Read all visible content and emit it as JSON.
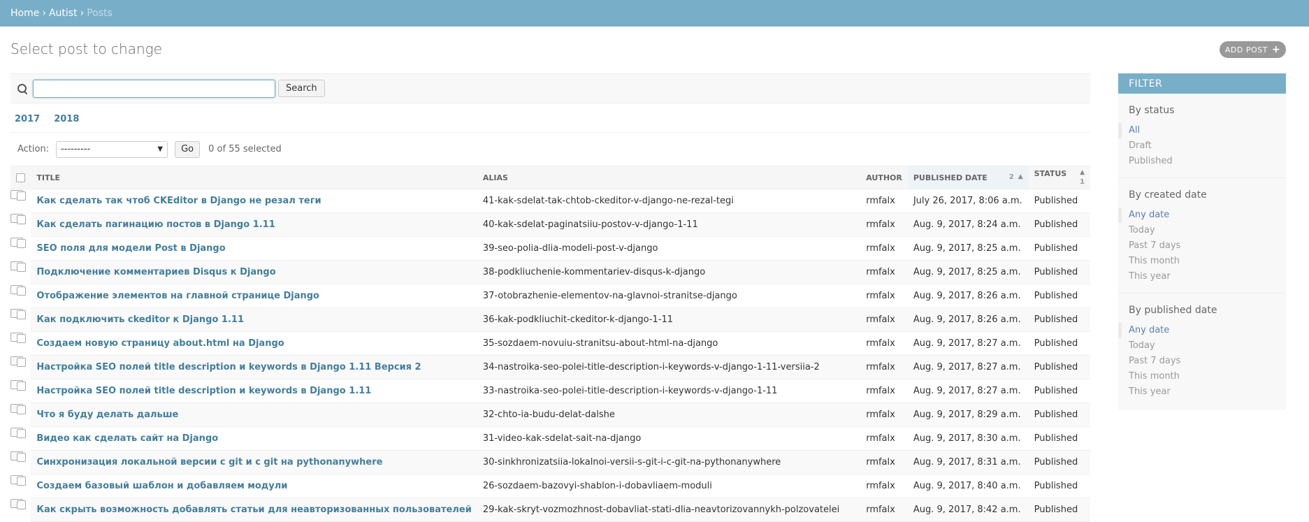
{
  "breadcrumbs": {
    "home": "Home",
    "sep1": "›",
    "app": "Autist",
    "sep2": "›",
    "current": "Posts"
  },
  "page_title": "Select post to change",
  "add_button": {
    "label": "Add post",
    "icon": "+"
  },
  "search": {
    "value": "",
    "placeholder": "",
    "button": "Search"
  },
  "date_hierarchy": [
    "2017",
    "2018"
  ],
  "actions": {
    "label": "Action:",
    "selected_option": "---------",
    "go": "Go",
    "selected_count": "0 of 55 selected"
  },
  "table": {
    "headers": {
      "title": "Title",
      "alias": "Alias",
      "author": "Author",
      "published": "Published date",
      "published_sort": "2",
      "status": "Status",
      "status_sort": "1"
    },
    "rows": [
      {
        "title": "Как сделать так чтоб CKEditor в Django не резал теги",
        "alias": "41-kak-sdelat-tak-chtob-ckeditor-v-django-ne-rezal-tegi",
        "author": "rmfalx",
        "published": "July 26, 2017, 8:06 a.m.",
        "status": "Published"
      },
      {
        "title": "Как сделать пагинацию постов в Django 1.11",
        "alias": "40-kak-sdelat-paginatsiiu-postov-v-django-1-11",
        "author": "rmfalx",
        "published": "Aug. 9, 2017, 8:24 a.m.",
        "status": "Published"
      },
      {
        "title": "SEO поля для модели Post в Django",
        "alias": "39-seo-polia-dlia-modeli-post-v-django",
        "author": "rmfalx",
        "published": "Aug. 9, 2017, 8:25 a.m.",
        "status": "Published"
      },
      {
        "title": "Подключение комментариев Disqus к Django",
        "alias": "38-podkliuchenie-kommentariev-disqus-k-django",
        "author": "rmfalx",
        "published": "Aug. 9, 2017, 8:25 a.m.",
        "status": "Published"
      },
      {
        "title": "Отображение элементов на главной странице Django",
        "alias": "37-otobrazhenie-elementov-na-glavnoi-stranitse-django",
        "author": "rmfalx",
        "published": "Aug. 9, 2017, 8:26 a.m.",
        "status": "Published"
      },
      {
        "title": "Как подключить ckeditor к Django 1.11",
        "alias": "36-kak-podkliuchit-ckeditor-k-django-1-11",
        "author": "rmfalx",
        "published": "Aug. 9, 2017, 8:26 a.m.",
        "status": "Published"
      },
      {
        "title": "Создаем новую страницу about.html на Django",
        "alias": "35-sozdaem-novuiu-stranitsu-about-html-na-django",
        "author": "rmfalx",
        "published": "Aug. 9, 2017, 8:27 a.m.",
        "status": "Published"
      },
      {
        "title": "Настройка SEO полей title description и keywords в Django 1.11 Версия 2",
        "alias": "34-nastroika-seo-polei-title-description-i-keywords-v-django-1-11-versiia-2",
        "author": "rmfalx",
        "published": "Aug. 9, 2017, 8:27 a.m.",
        "status": "Published"
      },
      {
        "title": "Настройка SEO полей title description и keywords в Django 1.11",
        "alias": "33-nastroika-seo-polei-title-description-i-keywords-v-django-1-11",
        "author": "rmfalx",
        "published": "Aug. 9, 2017, 8:27 a.m.",
        "status": "Published"
      },
      {
        "title": "Что я буду делать дальше",
        "alias": "32-chto-ia-budu-delat-dalshe",
        "author": "rmfalx",
        "published": "Aug. 9, 2017, 8:29 a.m.",
        "status": "Published"
      },
      {
        "title": "Видео как сделать сайт на Django",
        "alias": "31-video-kak-sdelat-sait-na-django",
        "author": "rmfalx",
        "published": "Aug. 9, 2017, 8:30 a.m.",
        "status": "Published"
      },
      {
        "title": "Синхронизация локальной версии с git и с git на pythonanywhere",
        "alias": "30-sinkhronizatsiia-lokalnoi-versii-s-git-i-c-git-na-pythonanywhere",
        "author": "rmfalx",
        "published": "Aug. 9, 2017, 8:31 a.m.",
        "status": "Published"
      },
      {
        "title": "Создаем базовый шаблон и добавляем модули",
        "alias": "26-sozdaem-bazovyi-shablon-i-dobavliaem-moduli",
        "author": "rmfalx",
        "published": "Aug. 9, 2017, 8:40 a.m.",
        "status": "Published"
      },
      {
        "title": "Как скрыть возможность добавлять статьи для неавторизованных пользователей",
        "alias": "29-kak-skryt-vozmozhnost-dobavliat-stati-dlia-neavtorizovannykh-polzovatelei",
        "author": "rmfalx",
        "published": "Aug. 9, 2017, 8:42 a.m.",
        "status": "Published"
      }
    ]
  },
  "filter": {
    "title": "Filter",
    "groups": [
      {
        "heading": "By status",
        "items": [
          "All",
          "Draft",
          "Published"
        ],
        "selected": 0
      },
      {
        "heading": "By created date",
        "items": [
          "Any date",
          "Today",
          "Past 7 days",
          "This month",
          "This year"
        ],
        "selected": 0
      },
      {
        "heading": "By published date",
        "items": [
          "Any date",
          "Today",
          "Past 7 days",
          "This month",
          "This year"
        ],
        "selected": 0
      }
    ]
  },
  "colors": {
    "header": "#79aec8",
    "link": "#447e9b",
    "filter_selected": "#5b80b2"
  },
  "icons": {
    "search": "search-icon",
    "add": "plus-icon",
    "sort": "sort-ascending-icon"
  }
}
